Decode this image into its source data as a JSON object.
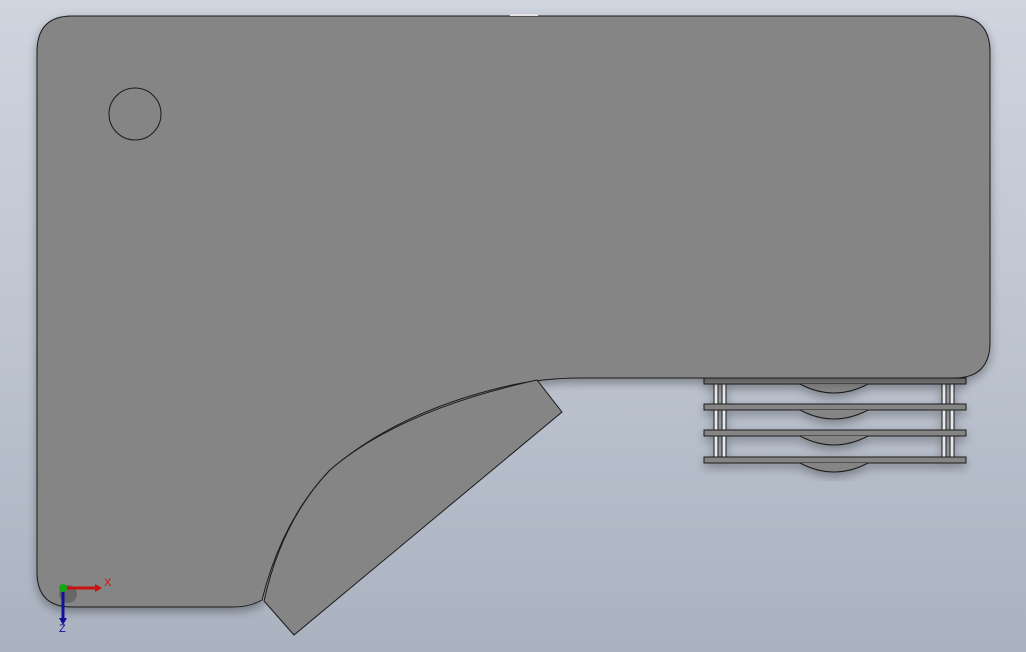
{
  "viewport": {
    "background_top": "#cfd4df",
    "background_bottom": "#aab2c0",
    "model_face_color": "#858585",
    "model_edge_color": "#1a1a1a"
  },
  "triad": {
    "x_label": "X",
    "z_label": "Z",
    "x_color": "#cc1111",
    "y_color": "#11aa11",
    "z_color": "#111199"
  }
}
